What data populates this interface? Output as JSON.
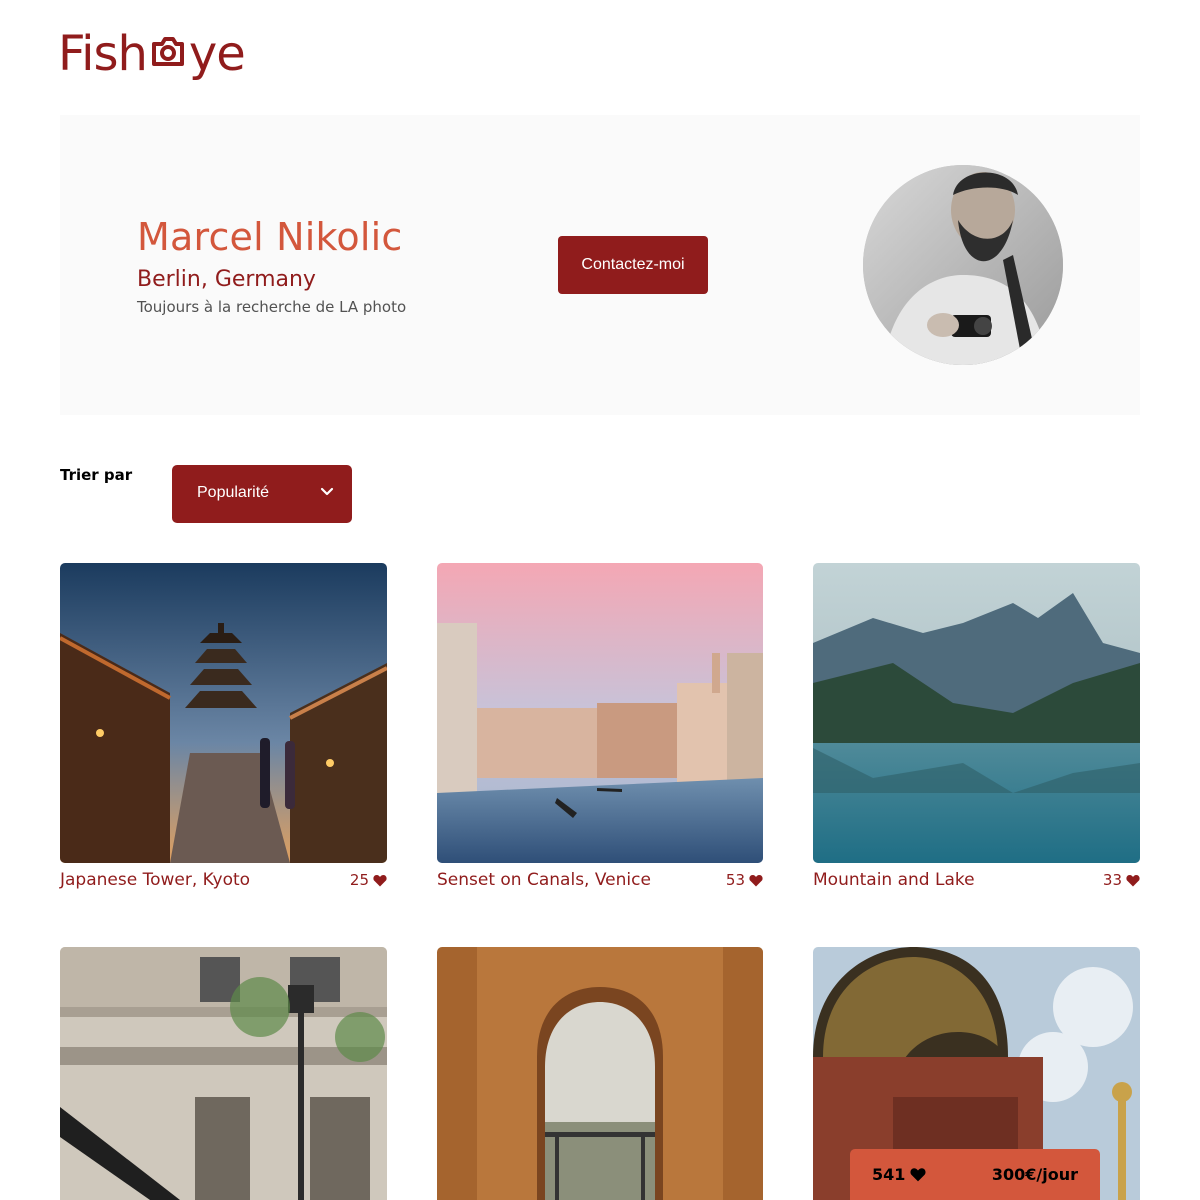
{
  "logo": {
    "text_before": "Fish",
    "text_after": "ye"
  },
  "photographer": {
    "name": "Marcel Nikolic",
    "location": "Berlin, Germany",
    "tagline": "Toujours à la recherche de LA photo",
    "contact_label": "Contactez-moi"
  },
  "sort": {
    "label": "Trier par",
    "selected": "Popularité"
  },
  "media": [
    {
      "title": "Japanese Tower, Kyoto",
      "likes": "25",
      "scene": "kyoto"
    },
    {
      "title": "Senset on Canals, Venice",
      "likes": "53",
      "scene": "venice"
    },
    {
      "title": "Mountain and Lake",
      "likes": "33",
      "scene": "mountain"
    },
    {
      "title": "",
      "likes": "",
      "scene": "paris-street"
    },
    {
      "title": "",
      "likes": "",
      "scene": "arch"
    },
    {
      "title": "",
      "likes": "",
      "scene": "dome"
    }
  ],
  "stats": {
    "total_likes": "541",
    "price": "300€/jour"
  },
  "colors": {
    "primary": "#901c1c",
    "secondary": "#d3573c",
    "header_bg": "#fafafa"
  }
}
